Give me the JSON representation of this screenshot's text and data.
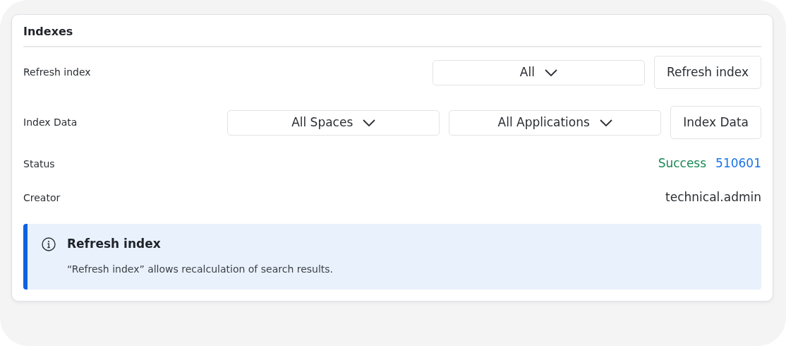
{
  "panel": {
    "title": "Indexes"
  },
  "rows": [
    {
      "kind": "controls",
      "label": "Refresh index",
      "dropdowns": [
        "All"
      ],
      "button": "Refresh index"
    },
    {
      "kind": "controls",
      "label": "Index Data",
      "dropdowns": [
        "All Spaces",
        "All Applications"
      ],
      "button": "Index Data"
    },
    {
      "kind": "status",
      "label": "Status",
      "status": "Success",
      "job": "510601"
    },
    {
      "kind": "text",
      "label": "Creator",
      "value": "technical.admin"
    }
  ],
  "callout": {
    "title": "Refresh index",
    "text": "“Refresh index” allows recalculation of search results."
  }
}
